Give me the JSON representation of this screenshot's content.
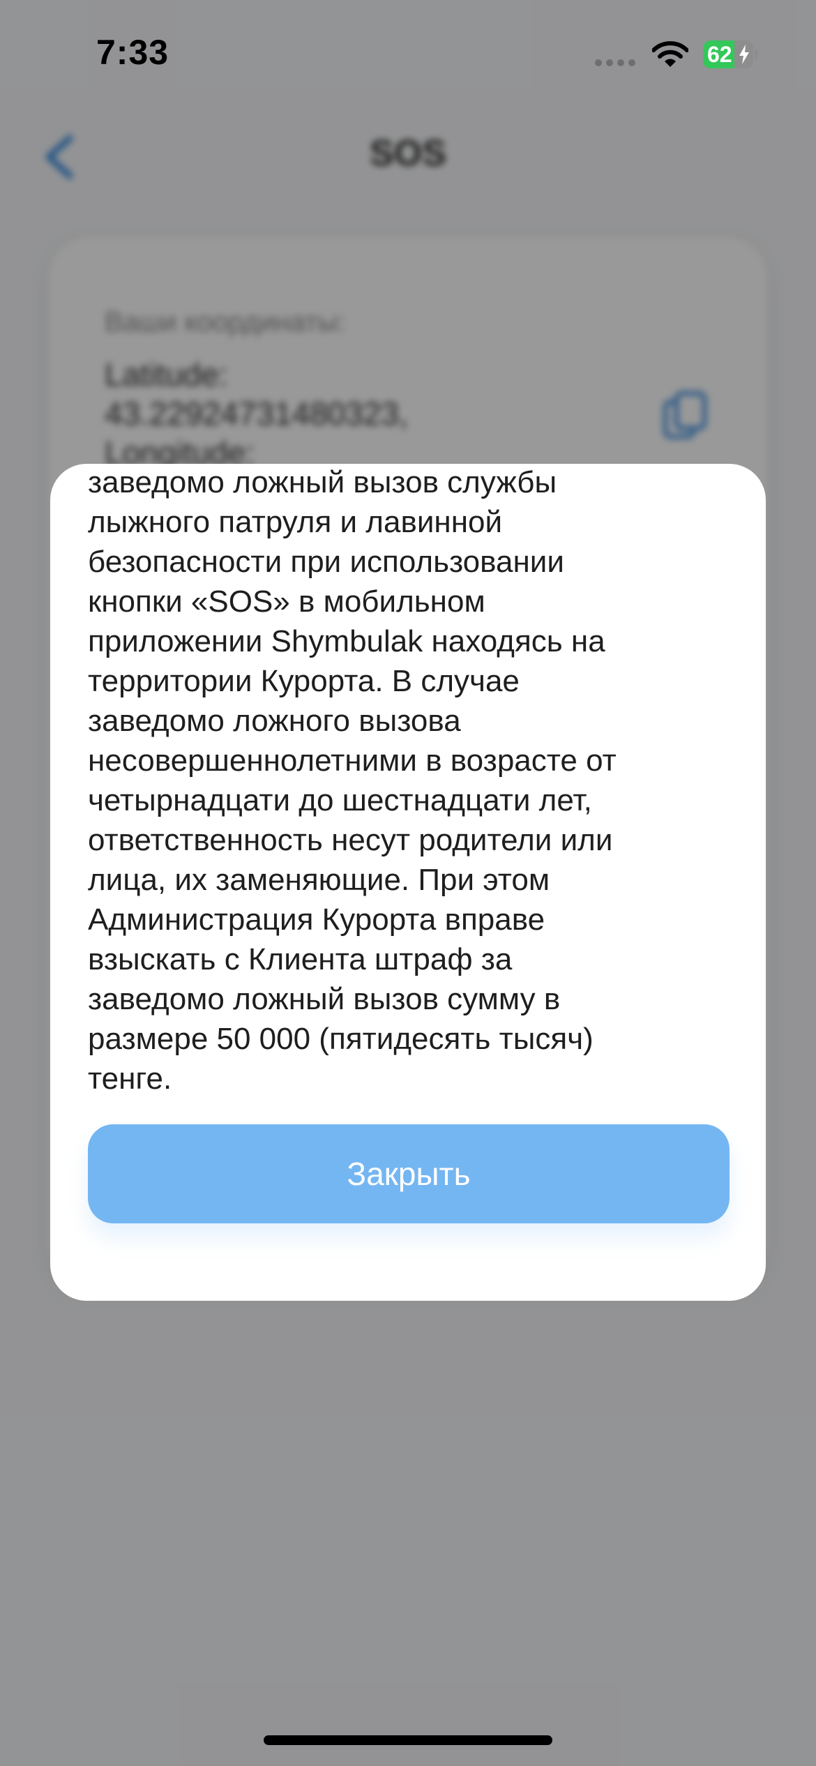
{
  "status_bar": {
    "time": "7:33",
    "battery_level": "62",
    "battery_fraction": 0.62,
    "charging": true
  },
  "header": {
    "title": "SOS",
    "back_icon": "chevron-left-icon"
  },
  "coordinates_card": {
    "label": "Ваши координаты:",
    "latitude_label": "Latitude:",
    "latitude_value": "43.22924731480323,",
    "longitude_label": "Longitude:",
    "copy_icon": "copy-icon"
  },
  "modal": {
    "body_text": "заведомо ложный вызов службы\nлыжного патруля и лавинной\nбезопасности при использовании\nкнопки «SOS» в мобильном\nприложении Shymbulak находясь на\nтерритории Курорта. В случае\nзаведомо ложного вызова\nнесовершеннолетними в возрасте от\nчетырнадцати до шестнадцати лет,\nответственность несут родители или\nлица, их заменяющие. При этом\nАдминистрация Курорта вправе\nвзыскать с Клиента штраф за\nзаведомо ложный вызов сумму в\nразмере 50 000 (пятидесять тысяч)\nтенге.",
    "close_label": "Закрыть"
  },
  "colors": {
    "accent": "#74b6f2",
    "battery_green": "#34c759",
    "overlay": "rgba(0,0,0,0.40)"
  }
}
